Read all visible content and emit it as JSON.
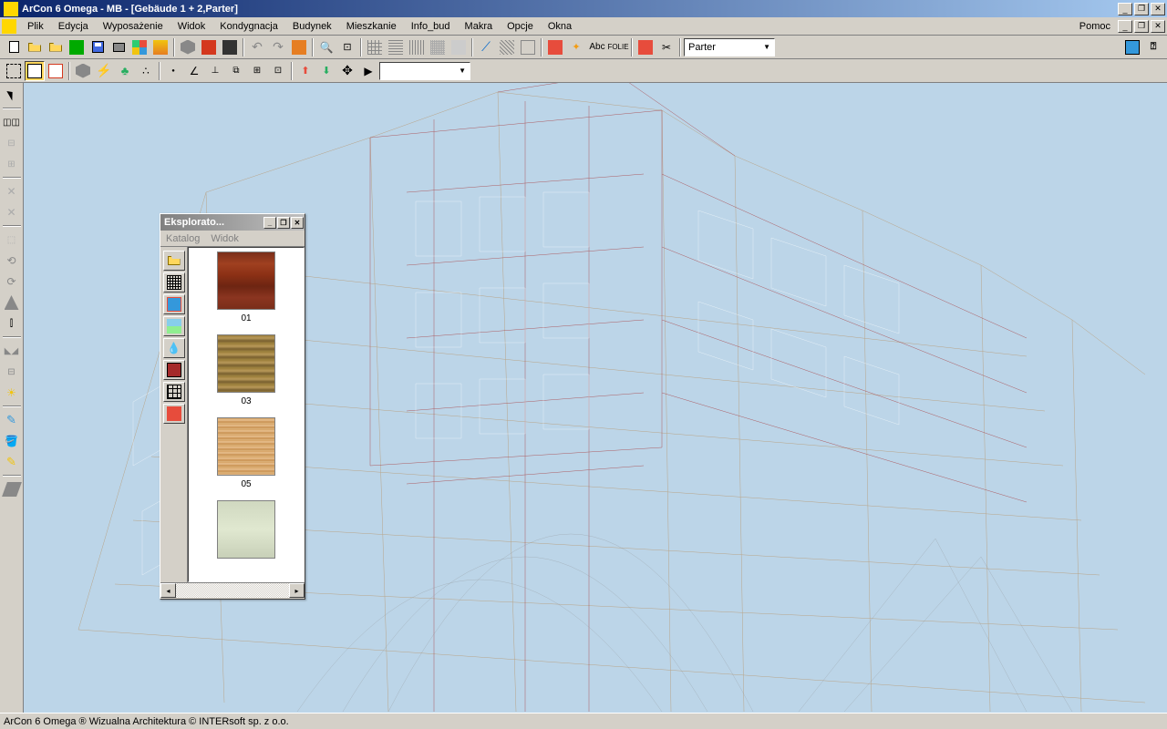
{
  "title": "ArCon 6 Omega - MB - [Gebäude 1 + 2,Parter]",
  "menu": {
    "items": [
      "Plik",
      "Edycja",
      "Wyposażenie",
      "Widok",
      "Kondygnacja",
      "Budynek",
      "Mieszkanie",
      "Info_bud",
      "Makra",
      "Opcje",
      "Okna"
    ],
    "help": "Pomoc"
  },
  "floor_select": "Parter",
  "explorer": {
    "title": "Eksplorato...",
    "menu": [
      "Katalog",
      "Widok"
    ],
    "textures": [
      {
        "label": "01",
        "cls": "t-wood1"
      },
      {
        "label": "03",
        "cls": "t-wood2"
      },
      {
        "label": "05",
        "cls": "t-wood3"
      },
      {
        "label": "",
        "cls": "t-light"
      }
    ]
  },
  "status": "ArCon 6 Omega ® Wizualna Architektura © INTERsoft sp. z o.o."
}
